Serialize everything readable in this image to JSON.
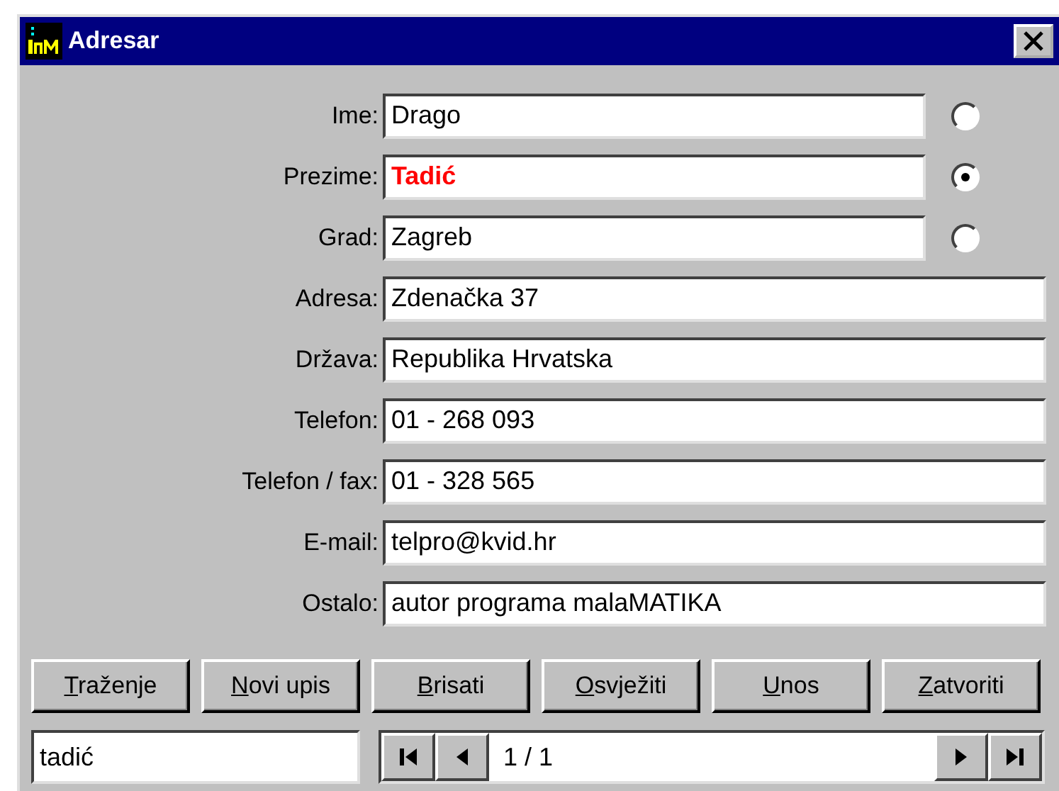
{
  "window": {
    "title": "Adresar"
  },
  "fields": [
    {
      "label": "Ime:",
      "value": "Drago",
      "highlighted": false,
      "radio": {
        "selected": false
      }
    },
    {
      "label": "Prezime:",
      "value": "Tadić",
      "highlighted": true,
      "radio": {
        "selected": true
      }
    },
    {
      "label": "Grad:",
      "value": "Zagreb",
      "highlighted": false,
      "radio": {
        "selected": false
      }
    },
    {
      "label": "Adresa:",
      "value": "Zdenačka 37",
      "highlighted": false
    },
    {
      "label": "Država:",
      "value": "Republika Hrvatska",
      "highlighted": false
    },
    {
      "label": "Telefon:",
      "value": "01 - 268 093",
      "highlighted": false
    },
    {
      "label": "Telefon / fax:",
      "value": "01 - 328 565",
      "highlighted": false
    },
    {
      "label": "E-mail:",
      "value": "telpro@kvid.hr",
      "highlighted": false
    },
    {
      "label": "Ostalo:",
      "value": "autor programa malaMATIKA",
      "highlighted": false
    }
  ],
  "buttons": [
    {
      "label": "Traženje"
    },
    {
      "label": "Novi upis"
    },
    {
      "label": "Brisati"
    },
    {
      "label": "Osvježiti"
    },
    {
      "label": "Unos"
    },
    {
      "label": "Zatvoriti"
    }
  ],
  "search": {
    "value": "tadić"
  },
  "navigator": {
    "position": "1 / 1"
  }
}
